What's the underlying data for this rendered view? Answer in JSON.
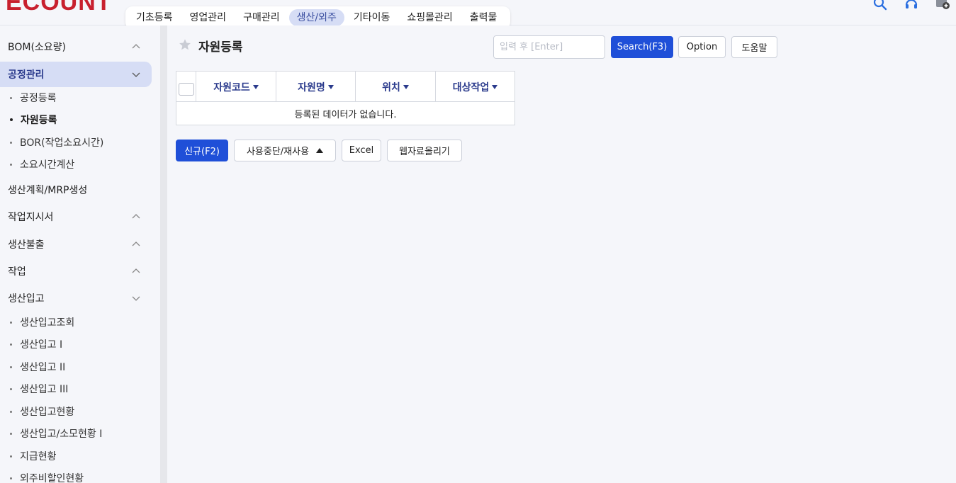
{
  "header": {
    "logo_text": "ECOUNT",
    "nav": [
      {
        "label": "기초등록",
        "active": false
      },
      {
        "label": "영업관리",
        "active": false
      },
      {
        "label": "구매관리",
        "active": false
      },
      {
        "label": "생산/외주",
        "active": true
      },
      {
        "label": "기타이동",
        "active": false
      },
      {
        "label": "쇼핑몰관리",
        "active": false
      },
      {
        "label": "출력물",
        "active": false
      }
    ],
    "icons": [
      "search-icon",
      "headset-icon",
      "notification-icon"
    ]
  },
  "sidebar": {
    "groups": [
      {
        "label": "BOM(소요량)",
        "chevron": "up"
      },
      {
        "label": "공정관리",
        "chevron": "down",
        "active": true
      },
      {
        "label": "생산계획/MRP생성",
        "chevron": ""
      },
      {
        "label": "작업지시서",
        "chevron": "up"
      },
      {
        "label": "생산불출",
        "chevron": "up"
      },
      {
        "label": "작업",
        "chevron": "up"
      },
      {
        "label": "생산입고",
        "chevron": "down"
      }
    ],
    "process_items": [
      "공정등록",
      "자원등록",
      "BOR(작업소요시간)",
      "소요시간계산"
    ],
    "production_items": [
      "생산입고조회",
      "생산입고 I",
      "생산입고 II",
      "생산입고 III",
      "생산입고현황",
      "생산입고/소모현황 I",
      "지급현황",
      "외주비할인현황"
    ]
  },
  "main": {
    "title": "자원등록",
    "search": {
      "placeholder": "입력 후 [Enter]",
      "value": ""
    },
    "buttons": {
      "search": "Search(F3)",
      "option": "Option",
      "help": "도움말"
    },
    "table": {
      "columns": [
        "자원코드",
        "자원명",
        "위치",
        "대상작업"
      ],
      "empty_message": "등록된 데이터가 없습니다."
    },
    "actions": {
      "new": "신규(F2)",
      "toggle_use": "사용중단/재사용",
      "excel": "Excel",
      "upload": "웹자료올리기"
    }
  }
}
